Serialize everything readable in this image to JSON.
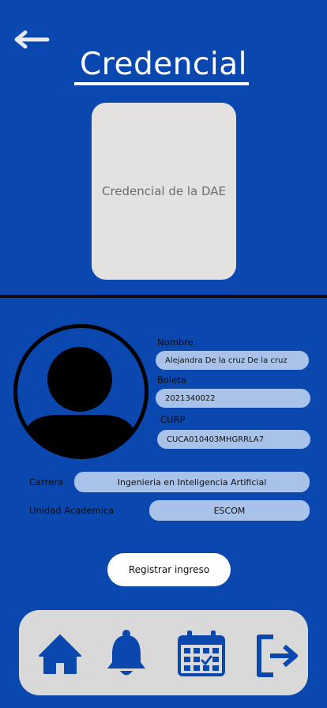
{
  "header": {
    "title": "Credencial"
  },
  "card": {
    "placeholder": "Credencial de la DAE"
  },
  "fields": {
    "nombre": {
      "label": "Nombre",
      "value": "Alejandra De la cruz De la cruz"
    },
    "boleta": {
      "label": "Boleta",
      "value": "2021340022"
    },
    "curp": {
      "label": "CURP",
      "value": "CUCA010403MHGRRLA7"
    },
    "carrera": {
      "label": "Carrera",
      "value": "Ingenieria en Inteligencia Artificial"
    },
    "unidad": {
      "label": "Unidad Academica",
      "value": "ESCOM"
    }
  },
  "actions": {
    "register_label": "Registrar ingreso"
  },
  "nav": {
    "items": [
      "home-icon",
      "bell-icon",
      "calendar-icon",
      "logout-icon"
    ]
  },
  "colors": {
    "background": "#0a48b0",
    "pill": "#a9c2ea",
    "card": "#e4e1e1",
    "navbar": "#d9d9d9",
    "icon": "#0a48b0"
  }
}
